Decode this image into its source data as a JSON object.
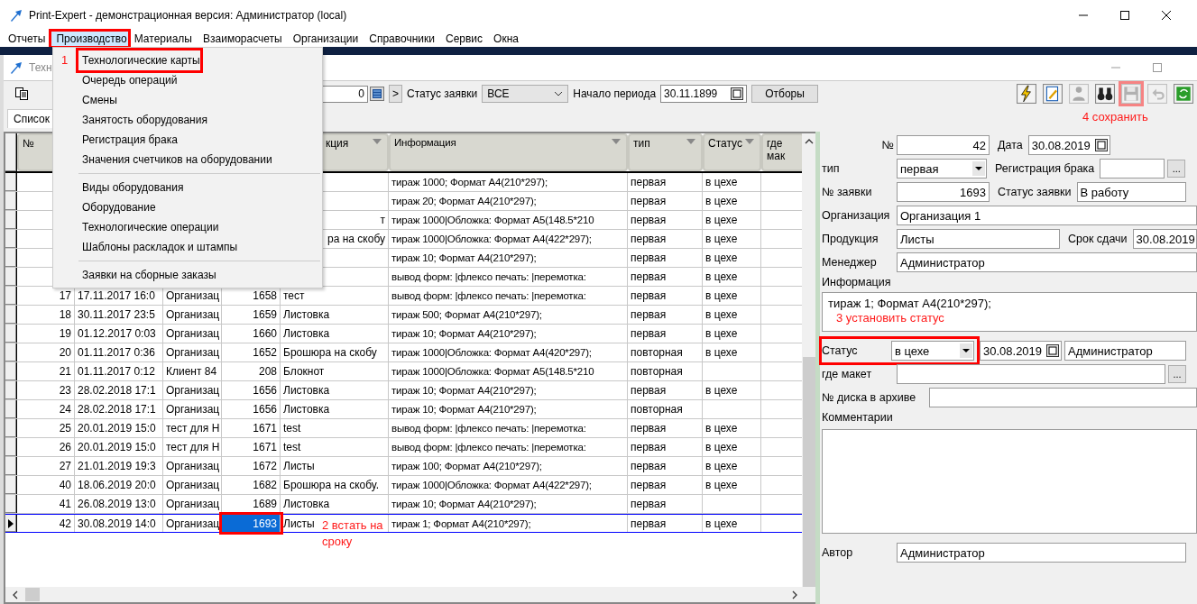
{
  "window": {
    "title": "Print-Expert - демонстрационная версия: Администратор (local)"
  },
  "menu_bar": [
    {
      "label": "Отчеты",
      "selected": false,
      "highlighted": false
    },
    {
      "label": "Производство",
      "selected": true,
      "highlighted": true
    },
    {
      "label": "Материалы",
      "selected": false,
      "highlighted": false
    },
    {
      "label": "Взаиморасчеты",
      "selected": false,
      "highlighted": false
    },
    {
      "label": "Организации",
      "selected": false,
      "highlighted": false
    },
    {
      "label": "Справочники",
      "selected": false,
      "highlighted": false
    },
    {
      "label": "Сервис",
      "selected": false,
      "highlighted": false
    },
    {
      "label": "Окна",
      "selected": false,
      "highlighted": false
    }
  ],
  "dropdown_menu": {
    "annotation": "1",
    "groups": [
      [
        {
          "label": "Технологические карты",
          "highlighted": true
        },
        {
          "label": "Очередь операций",
          "highlighted": false
        },
        {
          "label": "Смены",
          "highlighted": false
        },
        {
          "label": "Занятость оборудования",
          "highlighted": false
        },
        {
          "label": "Регистрация брака",
          "highlighted": false
        },
        {
          "label": "Значения счетчиков на оборудовании",
          "highlighted": false
        }
      ],
      [
        {
          "label": "Виды оборудования",
          "highlighted": false
        },
        {
          "label": "Оборудование",
          "highlighted": false
        },
        {
          "label": "Технологические операции",
          "highlighted": false
        },
        {
          "label": "Шаблоны раскладок и штампы",
          "highlighted": false
        }
      ],
      [
        {
          "label": "Заявки на сборные заказы",
          "highlighted": false
        }
      ]
    ]
  },
  "child_window": {
    "title": "Техн"
  },
  "toolbar": {
    "number_value": "0",
    "next_button": ">",
    "status_label": "Статус заявки",
    "status_value": "ВСЕ",
    "period_label": "Начало периода",
    "period_value": "30.11.1899",
    "filter_button": "Отборы",
    "annotation": "4 сохранить",
    "icons": [
      {
        "kind": "lightning",
        "disabled": false,
        "highlighted": false
      },
      {
        "kind": "edit",
        "disabled": false,
        "highlighted": false
      },
      {
        "kind": "person",
        "disabled": true,
        "highlighted": false
      },
      {
        "kind": "binoculars",
        "disabled": false,
        "highlighted": false
      },
      {
        "kind": "save",
        "disabled": true,
        "highlighted": true
      },
      {
        "kind": "undo",
        "disabled": true,
        "highlighted": false
      },
      {
        "kind": "refresh",
        "disabled": false,
        "highlighted": false
      }
    ]
  },
  "tabs": [
    {
      "label": "Список",
      "selected": true
    }
  ],
  "grid": {
    "headers": {
      "number": "№",
      "product": "кция",
      "info": "Информация",
      "type": "тип",
      "status": "Статус",
      "layout": "где мак"
    },
    "annotation": [
      "2 встать на",
      "сроку"
    ],
    "current_cell_highlighted": true,
    "rows": [
      {
        "product": "",
        "info": "тираж 1000; Формат А4(210*297);",
        "type": "первая",
        "status": "в цехе",
        "current": false
      },
      {
        "product": "",
        "info": "тираж 20; Формат А4(210*297);",
        "type": "первая",
        "status": "в цехе",
        "current": false
      },
      {
        "product": "т",
        "info": "тираж 1000|Обложка: Формат А5(148.5*210",
        "type": "первая",
        "status": "в цехе",
        "current": false
      },
      {
        "product": "ра на скобу",
        "info": "тираж 1000|Обложка: Формат А4(422*297);",
        "type": "первая",
        "status": "в цехе",
        "current": false
      },
      {
        "product": "",
        "info": "тираж 10; Формат А4(210*297);",
        "type": "первая",
        "status": "в цехе",
        "current": false
      },
      {
        "product": "",
        "info": "вывод форм: |флексо печать: |перемотка:",
        "type": "первая",
        "status": "в цехе",
        "current": false
      },
      {
        "no": "17",
        "date": "17.11.2017 16:0",
        "org": "Организац",
        "order": "1658",
        "product": "тест",
        "info": "вывод форм: |флексо печать: |перемотка:",
        "type": "первая",
        "status": "в цехе",
        "current": false
      },
      {
        "no": "18",
        "date": "30.11.2017 23:5",
        "org": "Организац",
        "order": "1659",
        "product": "Листовка",
        "info": "тираж 500; Формат А4(210*297);",
        "type": "первая",
        "status": "в цехе",
        "current": false
      },
      {
        "no": "19",
        "date": "01.12.2017 0:03",
        "org": "Организац",
        "order": "1660",
        "product": "Листовка",
        "info": "тираж 10; Формат А4(210*297);",
        "type": "первая",
        "status": "в цехе",
        "current": false
      },
      {
        "no": "20",
        "date": "01.11.2017 0:36",
        "org": "Организац",
        "order": "1652",
        "product": "Брошюра на скобу",
        "info": "тираж 1000|Обложка: Формат А4(420*297);",
        "type": "повторная",
        "status": "в цехе",
        "current": false
      },
      {
        "no": "21",
        "date": "01.11.2017 0:12",
        "org": "Клиент 84",
        "order": "208",
        "product": "Блокнот",
        "info": "тираж 1000|Обложка: Формат А5(148.5*210",
        "type": "повторная",
        "status": "",
        "current": false
      },
      {
        "no": "23",
        "date": "28.02.2018 17:1",
        "org": "Организац",
        "order": "1656",
        "product": "Листовка",
        "info": "тираж 10; Формат А4(210*297);",
        "type": "первая",
        "status": "в цехе",
        "current": false
      },
      {
        "no": "24",
        "date": "28.02.2018 17:1",
        "org": "Организац",
        "order": "1656",
        "product": "Листовка",
        "info": "тираж 10; Формат А4(210*297);",
        "type": "повторная",
        "status": "",
        "current": false
      },
      {
        "no": "25",
        "date": "20.01.2019 15:0",
        "org": "тест для Н",
        "order": "1671",
        "product": "test",
        "info": "вывод форм: |флексо печать: |перемотка:",
        "type": "первая",
        "status": "в цехе",
        "current": false
      },
      {
        "no": "26",
        "date": "20.01.2019 15:0",
        "org": "тест для Н",
        "order": "1671",
        "product": "test",
        "info": "вывод форм: |флексо печать: |перемотка:",
        "type": "первая",
        "status": "в цехе",
        "current": false
      },
      {
        "no": "27",
        "date": "21.01.2019 19:3",
        "org": "Организац",
        "order": "1672",
        "product": "Листы",
        "info": "тираж 100; Формат А4(210*297);",
        "type": "первая",
        "status": "в цехе",
        "current": false
      },
      {
        "no": "40",
        "date": "18.06.2019 20:0",
        "org": "Организац",
        "order": "1682",
        "product": "Брошюра на скобу.",
        "info": "тираж 1000|Обложка: Формат А4(422*297);",
        "type": "первая",
        "status": "в цехе",
        "current": false
      },
      {
        "no": "41",
        "date": "26.08.2019 13:0",
        "org": "Организац",
        "order": "1689",
        "product": "Листовка",
        "info": "тираж 10; Формат А4(210*297);",
        "type": "первая",
        "status": "",
        "current": false
      },
      {
        "no": "42",
        "date": "30.08.2019 14:0",
        "org": "Организац",
        "order": "1693",
        "product": "Листы",
        "info": "тираж 1; Формат А4(210*297);",
        "type": "первая",
        "status": "в цехе",
        "current": true
      }
    ]
  },
  "form": {
    "number": {
      "label": "№",
      "value": "42"
    },
    "date": {
      "label": "Дата",
      "value": "30.08.2019"
    },
    "type": {
      "label": "тип",
      "value": "первая"
    },
    "defect": {
      "label": "Регистрация брака",
      "button": "..."
    },
    "order": {
      "label": "№ заявки",
      "value": "1693"
    },
    "order_status": {
      "label": "Статус заявки",
      "value": "В работу"
    },
    "organization": {
      "label": "Организация",
      "value": "Организация 1"
    },
    "product": {
      "label": "Продукция",
      "value": "Листы"
    },
    "due": {
      "label": "Срок сдачи",
      "value": "30.08.2019"
    },
    "manager": {
      "label": "Менеджер",
      "value": "Администратор"
    },
    "info": {
      "label": "Информация",
      "value": "тираж 1; Формат А4(210*297);"
    },
    "annotation": "3 установить статус",
    "status": {
      "label": "Статус",
      "value": "в цехе",
      "date": "30.08.2019",
      "user": "Администратор",
      "highlighted": true
    },
    "layout": {
      "label": "где макет",
      "button": "..."
    },
    "disk": {
      "label": "№ диска в архиве"
    },
    "comments": {
      "label": "Комментарии"
    },
    "author": {
      "label": "Автор",
      "value": "Администратор"
    }
  }
}
